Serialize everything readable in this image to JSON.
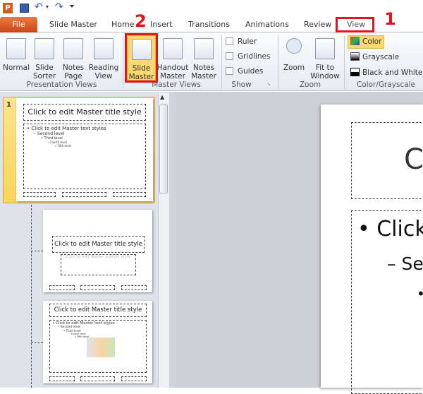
{
  "qat": {
    "app_icon": "powerpoint-icon",
    "save_icon": "save-icon",
    "undo_icon": "undo-icon",
    "redo_icon": "redo-icon",
    "customize_icon": "customize-qat-icon"
  },
  "tabs": [
    "File",
    "Slide Master",
    "Home",
    "Insert",
    "Transitions",
    "Animations",
    "Review",
    "View"
  ],
  "annotations": {
    "step1": "1",
    "step2": "2",
    "highlight_color": "#e0161b"
  },
  "ribbon": {
    "presentation_views": {
      "label": "Presentation Views",
      "buttons": [
        "Normal",
        "Slide Sorter",
        "Notes Page",
        "Reading View"
      ]
    },
    "master_views": {
      "label": "Master Views",
      "buttons": [
        "Slide Master",
        "Handout Master",
        "Notes Master"
      ]
    },
    "show": {
      "label": "Show",
      "checkboxes": [
        "Ruler",
        "Gridlines",
        "Guides"
      ]
    },
    "zoom": {
      "label": "Zoom",
      "buttons": [
        "Zoom",
        "Fit to Window"
      ]
    },
    "color": {
      "label": "Color/Grayscale",
      "options": [
        "Color",
        "Grayscale",
        "Black and White"
      ]
    }
  },
  "thumbnails": {
    "slide_number": "1",
    "master": {
      "title": "Click to edit Master title style",
      "levels": [
        "Click to edit Master text styles",
        "Second level",
        "Third level",
        "Fourth level",
        "Fifth level"
      ]
    },
    "layout1": {
      "title": "Click to edit Master title style",
      "subtitle": "Click to edit Master subtitle style"
    },
    "layout2": {
      "title": "Click to edit Master title style",
      "levels": [
        "Click to edit Master text styles",
        "Second level",
        "Third level",
        "Fourth level",
        "Fifth level"
      ]
    }
  },
  "slide": {
    "title": "C",
    "bullet1": "Click",
    "bullet2": "Se"
  }
}
